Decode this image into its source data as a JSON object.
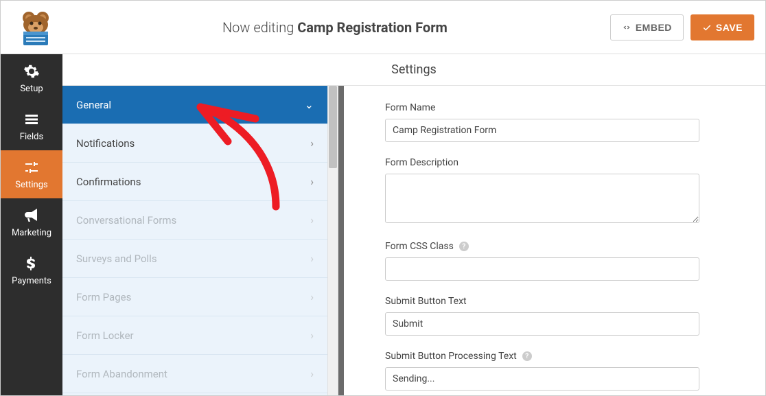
{
  "header": {
    "editing_prefix": "Now editing ",
    "form_title": "Camp Registration Form",
    "embed_label": "EMBED",
    "save_label": "SAVE"
  },
  "leftnav": {
    "items": [
      {
        "label": "Setup",
        "icon": "gear"
      },
      {
        "label": "Fields",
        "icon": "list"
      },
      {
        "label": "Settings",
        "icon": "sliders",
        "active": true
      },
      {
        "label": "Marketing",
        "icon": "bullhorn"
      },
      {
        "label": "Payments",
        "icon": "dollar"
      }
    ]
  },
  "settings_panel_title": "Settings",
  "sub_panel": {
    "items": [
      {
        "label": "General",
        "active": true
      },
      {
        "label": "Notifications"
      },
      {
        "label": "Confirmations"
      },
      {
        "label": "Conversational Forms",
        "disabled": true
      },
      {
        "label": "Surveys and Polls",
        "disabled": true
      },
      {
        "label": "Form Pages",
        "disabled": true
      },
      {
        "label": "Form Locker",
        "disabled": true
      },
      {
        "label": "Form Abandonment",
        "disabled": true
      }
    ]
  },
  "form": {
    "form_name_label": "Form Name",
    "form_name_value": "Camp Registration Form",
    "form_desc_label": "Form Description",
    "form_desc_value": "",
    "form_css_label": "Form CSS Class",
    "form_css_value": "",
    "submit_text_label": "Submit Button Text",
    "submit_text_value": "Submit",
    "submit_processing_label": "Submit Button Processing Text",
    "submit_processing_value": "Sending..."
  },
  "colors": {
    "accent": "#e27730",
    "primary_blue": "#1a6db2",
    "annotation_red": "#ed1c24"
  }
}
